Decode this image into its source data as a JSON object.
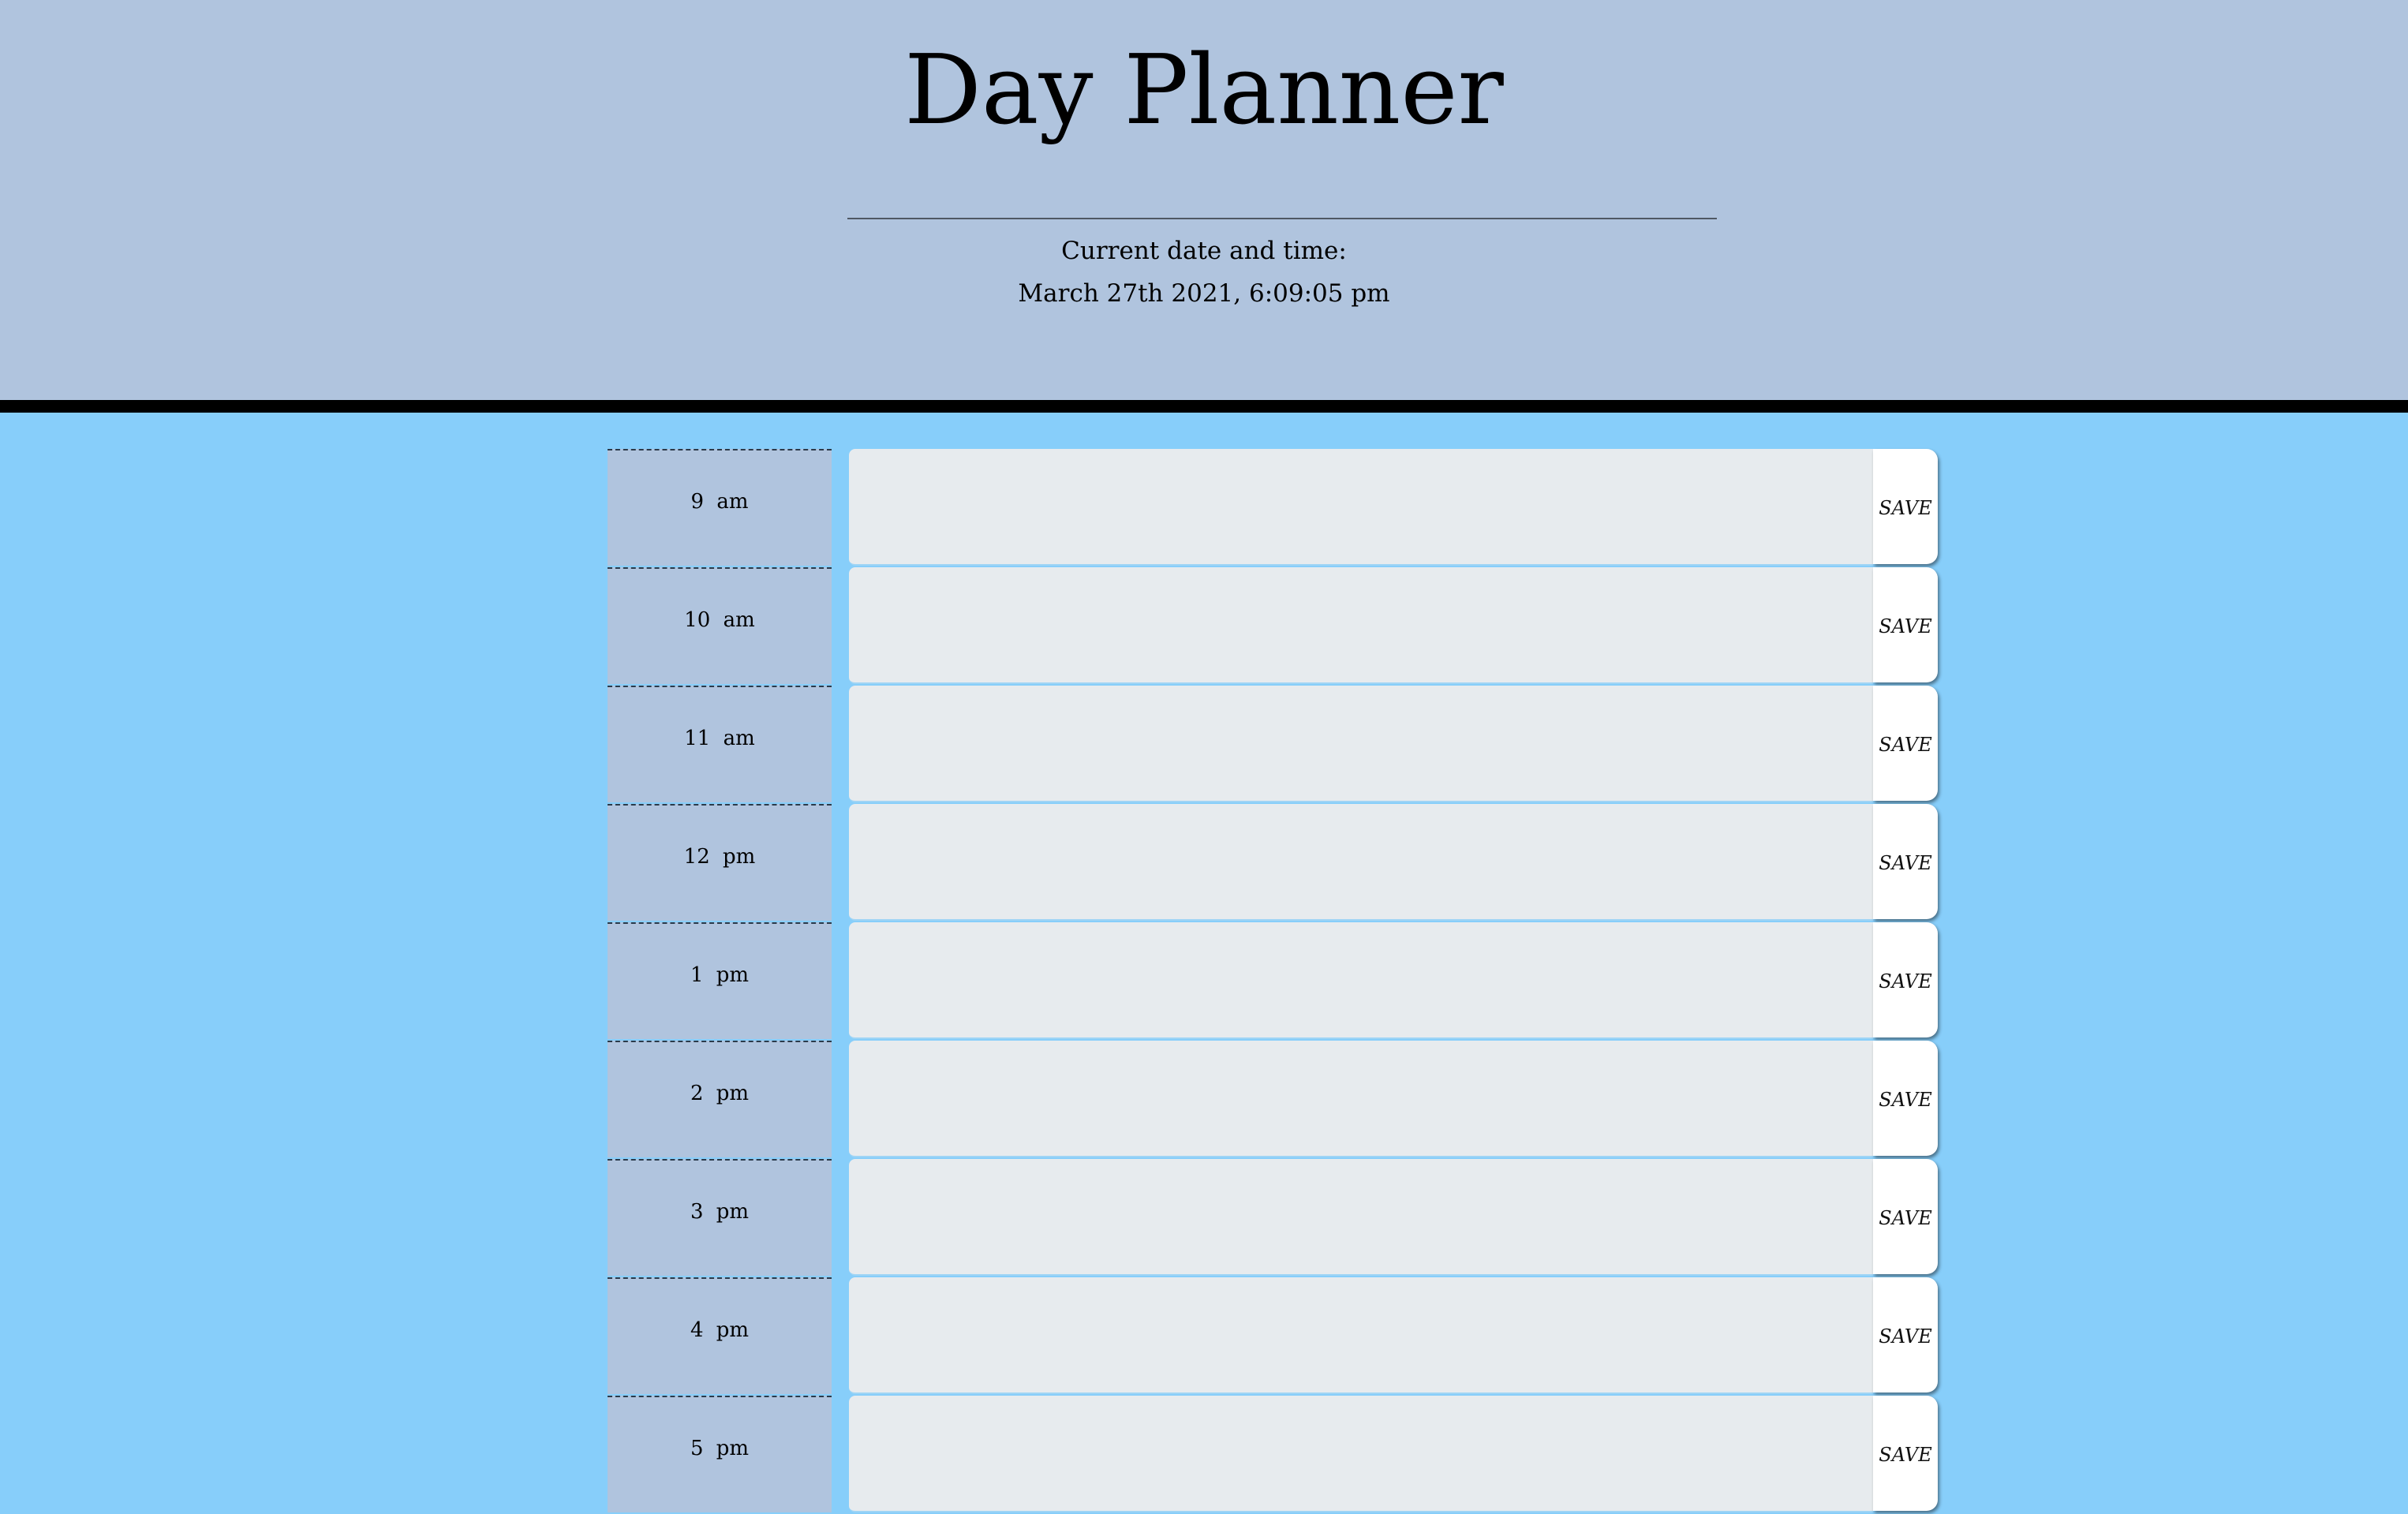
{
  "header": {
    "title": "Day Planner",
    "datetime_label": "Current date and time:",
    "datetime_value": "March 27th 2021, 6:09:05 pm"
  },
  "colors": {
    "page_background": "#87cefa",
    "header_background": "#b0c4de",
    "hour_background": "#b0c4de",
    "textarea_background": "#e7ebee",
    "save_button_background": "#ffffff"
  },
  "save_label": "SAVE",
  "rows": [
    {
      "hour": "9  am",
      "task": ""
    },
    {
      "hour": "10  am",
      "task": ""
    },
    {
      "hour": "11  am",
      "task": ""
    },
    {
      "hour": "12  pm",
      "task": ""
    },
    {
      "hour": "1  pm",
      "task": ""
    },
    {
      "hour": "2  pm",
      "task": ""
    },
    {
      "hour": "3  pm",
      "task": ""
    },
    {
      "hour": "4  pm",
      "task": ""
    },
    {
      "hour": "5  pm",
      "task": ""
    }
  ]
}
